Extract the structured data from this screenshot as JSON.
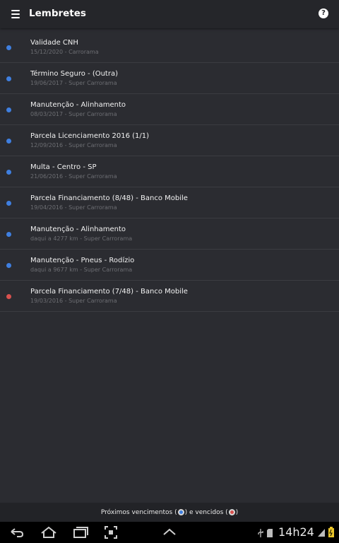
{
  "app_bar": {
    "title": "Lembretes",
    "menu_icon": "hamburger-menu-icon",
    "help_icon": "help-icon",
    "help_glyph": "?"
  },
  "colors": {
    "upcoming": "#3f7fe0",
    "overdue": "#d9514e",
    "background": "#2b2c31",
    "app_bar": "#25262a"
  },
  "reminders": [
    {
      "title": "Validade CNH",
      "subtitle": "15/12/2020 - Carrorama",
      "status": "upcoming"
    },
    {
      "title": "Término Seguro - (Outra)",
      "subtitle": "19/06/2017 - Super Carrorama",
      "status": "upcoming"
    },
    {
      "title": "Manutenção - Alinhamento",
      "subtitle": "08/03/2017 - Super Carrorama",
      "status": "upcoming"
    },
    {
      "title": "Parcela Licenciamento 2016 (1/1)",
      "subtitle": "12/09/2016 - Super Carrorama",
      "status": "upcoming"
    },
    {
      "title": "Multa - Centro - SP",
      "subtitle": "21/06/2016 - Super Carrorama",
      "status": "upcoming"
    },
    {
      "title": "Parcela Financiamento (8/48) - Banco Mobile",
      "subtitle": "19/04/2016 - Super Carrorama",
      "status": "upcoming"
    },
    {
      "title": "Manutenção - Alinhamento",
      "subtitle": "daqui a 4277 km - Super Carrorama",
      "status": "upcoming"
    },
    {
      "title": "Manutenção - Pneus - Rodízio",
      "subtitle": "daqui a 9677 km - Super Carrorama",
      "status": "upcoming"
    },
    {
      "title": "Parcela Financiamento (7/48) - Banco Mobile",
      "subtitle": "19/03/2016 - Super Carrorama",
      "status": "overdue"
    }
  ],
  "legend": {
    "upcoming_text": "Próximos vencimentos (",
    "middle_text": ") e vencidos (",
    "end_text": ")"
  },
  "system_bar": {
    "back_icon": "back-icon",
    "home_icon": "home-icon",
    "recents_icon": "recent-apps-icon",
    "screenshot_icon": "screenshot-icon",
    "up_icon": "chevron-up-icon",
    "usb_icon": "usb-icon",
    "sd_icon": "sd-card-icon",
    "signal_icon": "signal-icon",
    "battery_icon": "battery-icon",
    "time": "14h24"
  }
}
